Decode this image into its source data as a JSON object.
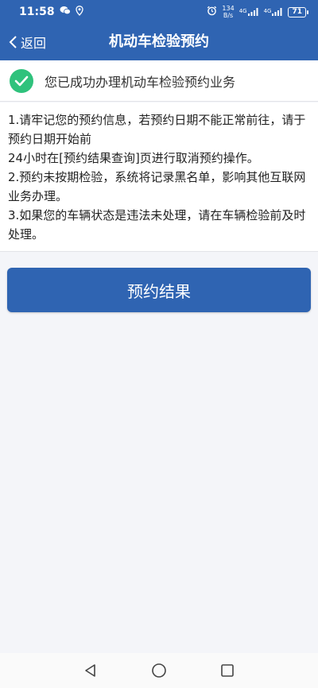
{
  "status_bar": {
    "time": "11:58",
    "net_speed_value": "134",
    "net_speed_unit": "B/s",
    "signal1_label": "4G",
    "signal2_label": "4G",
    "battery": "71"
  },
  "header": {
    "back_label": "返回",
    "title": "机动车检验预约"
  },
  "success": {
    "message": "您已成功办理机动车检验预约业务"
  },
  "notice": {
    "lines": [
      "1.请牢记您的预约信息，若预约日期不能正常前往，请于预约日期开始前",
      "24小时在[预约结果查询]页进行取消预约操作。",
      "2.预约未按期检验，系统将记录黑名单，影响其他互联网业务办理。",
      "3.如果您的车辆状态是违法未处理，请在车辆检验前及时处理。"
    ]
  },
  "result_button": {
    "label": "预约结果"
  },
  "colors": {
    "primary": "#2f64b2",
    "success": "#2fc27c",
    "background": "#f4f5f9"
  }
}
